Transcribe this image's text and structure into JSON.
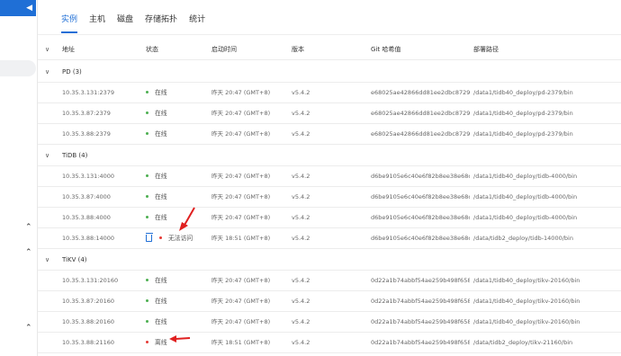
{
  "tabs": [
    "实例",
    "主机",
    "磁盘",
    "存储拓扑",
    "统计"
  ],
  "columns": {
    "addr": "地址",
    "status": "状态",
    "start": "启动时间",
    "version": "版本",
    "git": "Git 哈希值",
    "path": "部署路径"
  },
  "groups": [
    {
      "title": "PD (3)",
      "rows": [
        {
          "addr": "10.35.3.131:2379",
          "status": "在线",
          "start": "昨天 20:47 (GMT+8)",
          "version": "v5.4.2",
          "git": "e68025ae42866dd81ee2dbc8729...",
          "path": "/data1/tidb40_deploy/pd-2379/bin"
        },
        {
          "addr": "10.35.3.87:2379",
          "status": "在线",
          "start": "昨天 20:47 (GMT+8)",
          "version": "v5.4.2",
          "git": "e68025ae42866dd81ee2dbc8729...",
          "path": "/data1/tidb40_deploy/pd-2379/bin"
        },
        {
          "addr": "10.35.3.88:2379",
          "status": "在线",
          "start": "昨天 20:47 (GMT+8)",
          "version": "v5.4.2",
          "git": "e68025ae42866dd81ee2dbc8729...",
          "path": "/data1/tidb40_deploy/pd-2379/bin"
        }
      ]
    },
    {
      "title": "TiDB (4)",
      "rows": [
        {
          "addr": "10.35.3.131:4000",
          "status": "在线",
          "start": "昨天 20:47 (GMT+8)",
          "version": "v5.4.2",
          "git": "d6be9105e6c40e6f82b8ee38e68c...",
          "path": "/data1/tidb40_deploy/tidb-4000/bin"
        },
        {
          "addr": "10.35.3.87:4000",
          "status": "在线",
          "start": "昨天 20:47 (GMT+8)",
          "version": "v5.4.2",
          "git": "d6be9105e6c40e6f82b8ee38e68c...",
          "path": "/data1/tidb40_deploy/tidb-4000/bin"
        },
        {
          "addr": "10.35.3.88:4000",
          "status": "在线",
          "start": "昨天 20:47 (GMT+8)",
          "version": "v5.4.2",
          "git": "d6be9105e6c40e6f82b8ee38e68c...",
          "path": "/data1/tidb40_deploy/tidb-4000/bin"
        },
        {
          "addr": "10.35.3.88:14000",
          "status": "无法访问",
          "start": "昨天 18:51 (GMT+8)",
          "version": "v5.4.2",
          "git": "d6be9105e6c40e6f82b8ee38e68c...",
          "path": "/data/tidb2_deploy/tidb-14000/bin"
        }
      ]
    },
    {
      "title": "TiKV (4)",
      "rows": [
        {
          "addr": "10.35.3.131:20160",
          "status": "在线",
          "start": "昨天 20:47 (GMT+8)",
          "version": "v5.4.2",
          "git": "0d22a1b74abbf54ae259b498f658...",
          "path": "/data1/tidb40_deploy/tikv-20160/bin"
        },
        {
          "addr": "10.35.3.87:20160",
          "status": "在线",
          "start": "昨天 20:47 (GMT+8)",
          "version": "v5.4.2",
          "git": "0d22a1b74abbf54ae259b498f658...",
          "path": "/data1/tidb40_deploy/tikv-20160/bin"
        },
        {
          "addr": "10.35.3.88:20160",
          "status": "在线",
          "start": "昨天 20:47 (GMT+8)",
          "version": "v5.4.2",
          "git": "0d22a1b74abbf54ae259b498f658...",
          "path": "/data1/tidb40_deploy/tikv-20160/bin"
        },
        {
          "addr": "10.35.3.88:21160",
          "status": "离线",
          "start": "昨天 18:51 (GMT+8)",
          "version": "v5.4.2",
          "git": "0d22a1b74abbf54ae259b498f658...",
          "path": "/data/tidb2_deploy/tikv-21160/bin"
        }
      ]
    }
  ],
  "colors": {
    "accent": "#1f6fd6",
    "online": "#4caf50",
    "offline": "#e53935",
    "annotation": "#e02020"
  }
}
